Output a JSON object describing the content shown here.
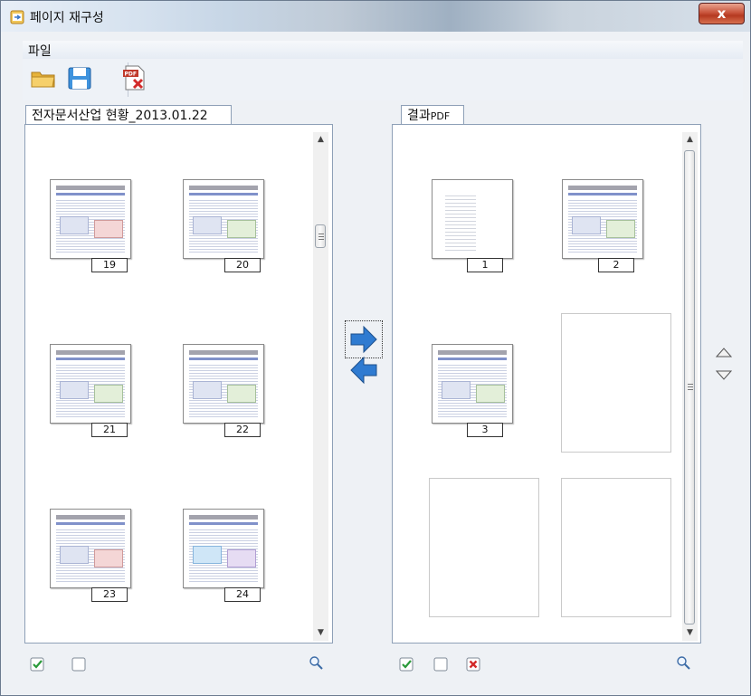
{
  "window": {
    "title": "페이지 재구성",
    "close_label": "x"
  },
  "menu": {
    "file": "파일"
  },
  "toolbar": {
    "open_icon": "folder-open-icon",
    "save_icon": "floppy-save-icon",
    "pdf_icon": "pdf-delete-icon"
  },
  "left_panel": {
    "tab_label": "전자문서산업 현황_2013.01.22",
    "pages": [
      {
        "number": "19"
      },
      {
        "number": "20"
      },
      {
        "number": "21"
      },
      {
        "number": "22"
      },
      {
        "number": "23"
      },
      {
        "number": "24"
      }
    ]
  },
  "right_panel": {
    "tab_label": "결과",
    "tab_suffix": "PDF",
    "pages": [
      {
        "number": "1"
      },
      {
        "number": "2"
      },
      {
        "number": "3"
      }
    ],
    "empty_slots": 3
  },
  "colors": {
    "accent_blue": "#2f7bd1",
    "check_green": "#2a9a3a",
    "delete_red": "#d22a2a",
    "pdf_red": "#c0392b"
  }
}
